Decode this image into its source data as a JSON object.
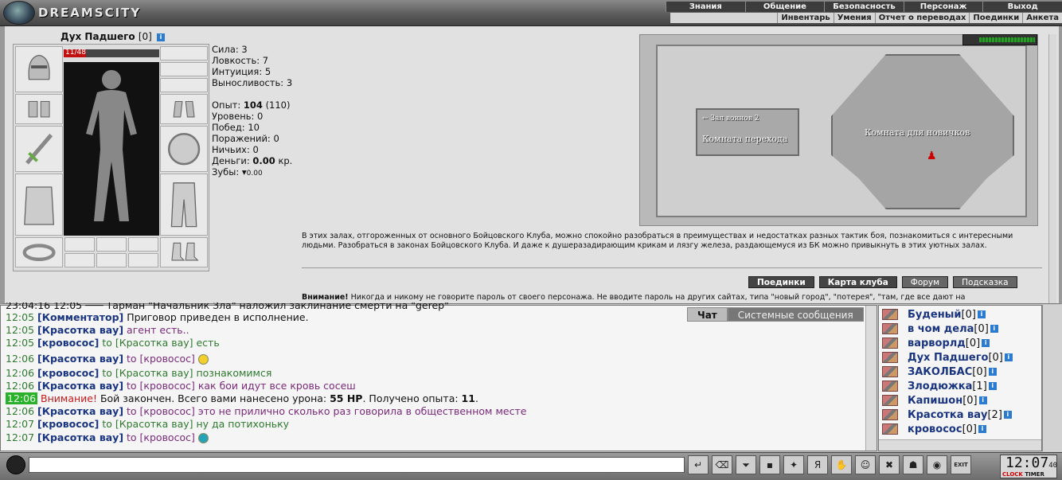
{
  "header": {
    "logo": "DREAMSCITY",
    "menu_main": [
      "Знания",
      "Общение",
      "Безопасность",
      "Персонаж",
      "Выход"
    ],
    "menu_sub": [
      "Инвентарь",
      "Умения",
      "Отчет о переводах",
      "Поединки",
      "Анкета"
    ]
  },
  "character": {
    "name": "Дух Падшего",
    "level": "[0]",
    "hp_current": "11",
    "hp_max": "48",
    "hp_fraction": 0.23,
    "stats": {
      "strength": "Сила: 3",
      "agility": "Ловкость: 7",
      "intuition": "Интуиция: 5",
      "endurance": "Выносливость: 3"
    },
    "progress": {
      "exp_label": "Опыт:",
      "exp_value": "104",
      "exp_next": "(110)",
      "level": "Уровень: 0",
      "wins": "Побед: 10",
      "losses": "Поражений: 0",
      "draws": "Ничьих: 0",
      "money_label": "Деньги:",
      "money_value": "0.00",
      "money_unit": "кр.",
      "teeth_label": "Зубы:",
      "teeth_value": "0.00"
    }
  },
  "map": {
    "room_left_sign": "← Зал воинов 2",
    "room_left": "Комната перехода",
    "room_right": "Комната для новичков"
  },
  "description": "В этих залах, отгороженных от основного Бойцовского Клуба, можно спокойно разобраться в преимуществах и недостатках разных тактик боя, познакомиться с интересными людьми. Разобраться в законах Бойцовского Клуба. И даже к душеразадирающим крикам и лязгу железа, раздающемуся из БК можно привыкнуть в этих уютных залах.",
  "buttons": {
    "fights": "Поединки",
    "club_map": "Карта клуба",
    "forum": "Форум",
    "hint": "Подсказка"
  },
  "warning": {
    "label": "Внимание!",
    "text": " Никогда и никому не говорите пароль от своего персонажа. Не вводите пароль на других сайтах, типа \"новый город\", \"потерея\", \"там, где все дают на"
  },
  "chat": {
    "tabs": [
      "Чат",
      "Системные сообщения"
    ],
    "partial_line": "23:04:16 12:05 ─── Тарман \"Начальник Зла\" наложил заклинание смерти на \"gerep\"",
    "lines": [
      {
        "time": "12:05",
        "nick": "[Комментатор]",
        "to": "",
        "msg": " Приговор приведен в исполнение."
      },
      {
        "time": "12:05",
        "nick": "[Красотка вау]",
        "to": "",
        "msg": " агент есть.."
      },
      {
        "time": "12:05",
        "nick": "[кровосос]",
        "to": " to [Красотка вау]",
        "msg": " есть"
      },
      {
        "time": "12:06",
        "nick": "[Красотка вау]",
        "to": " to [кровосос]",
        "msg": ""
      },
      {
        "time": "12:06",
        "nick": "[кровосос]",
        "to": " to [Красотка вау]",
        "msg": " познакомимся"
      },
      {
        "time": "12:06",
        "nick": "[Красотка вау]",
        "to": " to [кровосос]",
        "msg": " как бои идут все кровь сосеш"
      },
      {
        "time": "12:06",
        "nick": "",
        "to": "",
        "msg": ""
      },
      {
        "time": "12:06",
        "nick": "[Красотка вау]",
        "to": " to [кровосос]",
        "msg": " это не прилично сколько раз говорила в общественном месте"
      },
      {
        "time": "12:07",
        "nick": "[кровосос]",
        "to": " to [Красотка вау]",
        "msg": " ну да потихоньку"
      },
      {
        "time": "12:07",
        "nick": "[Красотка вау]",
        "to": " to [кровосос]",
        "msg": ""
      }
    ],
    "system": {
      "warn": "Внимание!",
      "text1": " Бой закончен. Всего вами нанесено урона: ",
      "damage": "55 HP",
      "text2": ". Получено опыта: ",
      "exp": "11",
      "text3": "."
    }
  },
  "users": [
    {
      "name": "Буденый",
      "lvl": "[0]"
    },
    {
      "name": "в чом дела",
      "lvl": "[0]"
    },
    {
      "name": "варворлд",
      "lvl": "[0]"
    },
    {
      "name": "Дух Падшего",
      "lvl": "[0]"
    },
    {
      "name": "ЗАКОЛБАС",
      "lvl": "[0]"
    },
    {
      "name": "Злодюжка",
      "lvl": "[1]"
    },
    {
      "name": "Капишон",
      "lvl": "[0]"
    },
    {
      "name": "Красотка вау",
      "lvl": "[2]"
    },
    {
      "name": "кровосос",
      "lvl": "[0]"
    }
  ],
  "clock": {
    "time": "12:07",
    "seconds": "40",
    "clock_label": "CLOCK",
    "timer_label": "TIMER",
    "exit_label": "EXIT"
  },
  "colors": {
    "nick": "#1a3580",
    "time": "#2f7a2f",
    "private_msg": "#7a2a7a",
    "warning": "#c21a1a",
    "hp": "#c01010"
  }
}
